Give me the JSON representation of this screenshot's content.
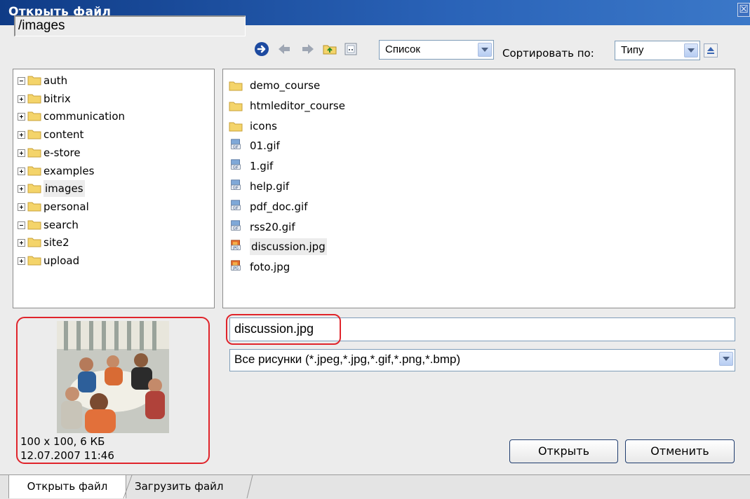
{
  "window": {
    "title": "Открыть файл",
    "close_glyph": "☒"
  },
  "toolbar": {
    "path": "/images",
    "view_mode": "Список",
    "sort_label": "Сортировать по:",
    "sort_value": "Типу",
    "icons": [
      "go-arrow-icon",
      "back-arrow-icon",
      "forward-arrow-icon",
      "folder-up-icon",
      "new-folder-icon"
    ]
  },
  "tree": {
    "items": [
      {
        "label": "auth",
        "expander": "empty"
      },
      {
        "label": "bitrix",
        "expander": "plus"
      },
      {
        "label": "communication",
        "expander": "plus"
      },
      {
        "label": "content",
        "expander": "plus"
      },
      {
        "label": "e-store",
        "expander": "plus"
      },
      {
        "label": "examples",
        "expander": "plus"
      },
      {
        "label": "images",
        "expander": "plus",
        "selected": true
      },
      {
        "label": "personal",
        "expander": "plus"
      },
      {
        "label": "search",
        "expander": "empty"
      },
      {
        "label": "site2",
        "expander": "plus"
      },
      {
        "label": "upload",
        "expander": "plus"
      }
    ]
  },
  "files": {
    "items": [
      {
        "name": "demo_course",
        "type": "folder"
      },
      {
        "name": "htmleditor_course",
        "type": "folder"
      },
      {
        "name": "icons",
        "type": "folder"
      },
      {
        "name": "01.gif",
        "type": "gif"
      },
      {
        "name": "1.gif",
        "type": "gif"
      },
      {
        "name": "help.gif",
        "type": "gif"
      },
      {
        "name": "pdf_doc.gif",
        "type": "gif"
      },
      {
        "name": "rss20.gif",
        "type": "gif"
      },
      {
        "name": "discussion.jpg",
        "type": "jpg",
        "selected": true
      },
      {
        "name": "foto.jpg",
        "type": "jpg"
      }
    ]
  },
  "preview": {
    "dimensions": "100 x 100, 6 КБ",
    "date": "12.07.2007 11:46"
  },
  "form": {
    "filename": "discussion.jpg",
    "filter": "Все рисунки (*.jpeg,*.jpg,*.gif,*.png,*.bmp)",
    "open_label": "Открыть",
    "cancel_label": "Отменить"
  },
  "tabs": [
    {
      "label": "Открыть файл",
      "active": true
    },
    {
      "label": "Загрузить файл",
      "active": false
    }
  ],
  "colors": {
    "title_bar": "#1b4d9f",
    "highlight": "#e0242b",
    "folder": "#f4d46a"
  }
}
